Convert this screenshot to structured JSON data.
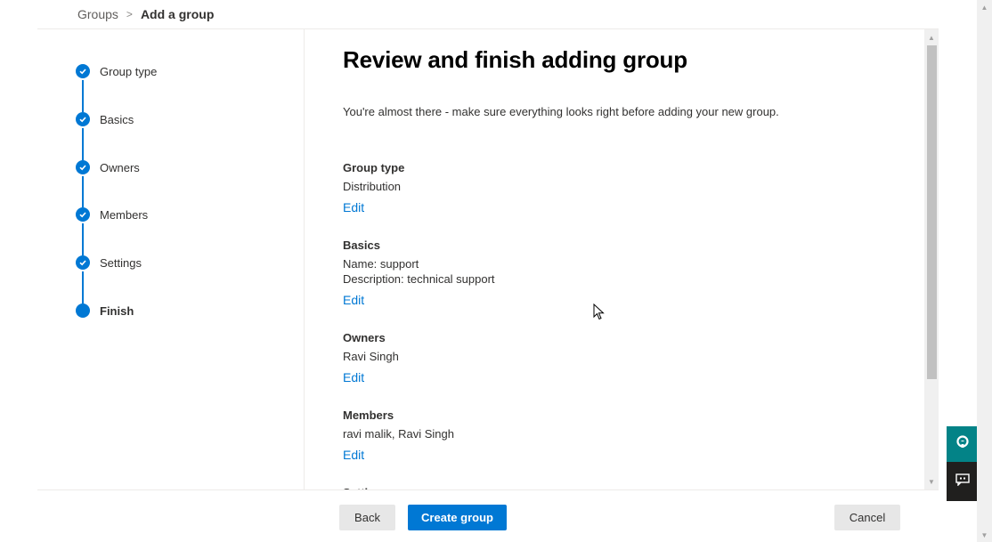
{
  "breadcrumb": {
    "parent": "Groups",
    "separator": ">",
    "current": "Add a group"
  },
  "stepper": {
    "steps": [
      {
        "label": "Group type",
        "state": "completed"
      },
      {
        "label": "Basics",
        "state": "completed"
      },
      {
        "label": "Owners",
        "state": "completed"
      },
      {
        "label": "Members",
        "state": "completed"
      },
      {
        "label": "Settings",
        "state": "completed"
      },
      {
        "label": "Finish",
        "state": "current"
      }
    ]
  },
  "main": {
    "title": "Review and finish adding group",
    "intro": "You're almost there - make sure everything looks right before adding your new group.",
    "sections": [
      {
        "heading": "Group type",
        "values": [
          "Distribution"
        ],
        "edit_label": "Edit"
      },
      {
        "heading": "Basics",
        "values": [
          "Name: support",
          "Description: technical support"
        ],
        "edit_label": "Edit"
      },
      {
        "heading": "Owners",
        "values": [
          "Ravi Singh"
        ],
        "edit_label": "Edit"
      },
      {
        "heading": "Members",
        "values": [
          "ravi malik, Ravi Singh"
        ],
        "edit_label": "Edit"
      },
      {
        "heading": "Settings",
        "values": [],
        "edit_label": ""
      }
    ]
  },
  "footer": {
    "back_label": "Back",
    "create_label": "Create group",
    "cancel_label": "Cancel"
  },
  "floating": {
    "help_icon": "headset-icon",
    "feedback_icon": "feedback-chat-icon"
  },
  "colors": {
    "accent": "#0078d4",
    "help_bg": "#038387",
    "feedback_bg": "#201f1e"
  }
}
